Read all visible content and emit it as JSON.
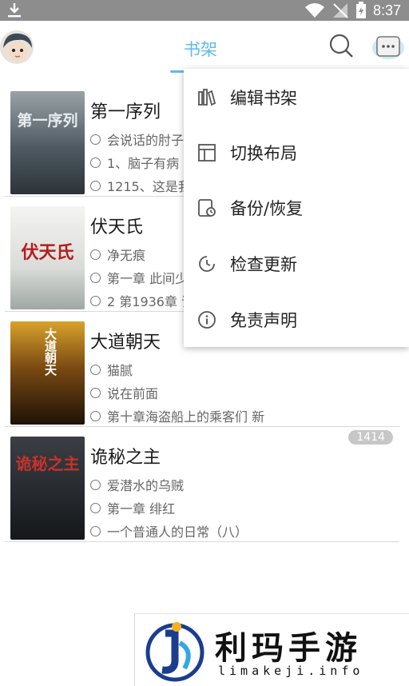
{
  "status_bar": {
    "time": "8:37"
  },
  "header": {
    "title": "书架"
  },
  "books": [
    {
      "title": "第一序列",
      "author": "会说话的肘子",
      "last_read": "1、脑子有病",
      "latest": "1215、这是我",
      "cover_text": "第一序列",
      "badge": ""
    },
    {
      "title": "伏天氏",
      "author": "净无痕",
      "last_read": "第一章 此间少",
      "latest": "2 第1936章 诸",
      "cover_text": "伏天氏",
      "badge": ""
    },
    {
      "title": "大道朝天",
      "author": "猫腻",
      "last_read": "说在前面",
      "latest": "第十章海盗船上的乘客们 新",
      "cover_text": "大道朝天",
      "badge": ""
    },
    {
      "title": "诡秘之主",
      "author": "爱潜水的乌贼",
      "last_read": "第一章 绯红",
      "latest": "一个普通人的日常（八）",
      "cover_text": "诡秘之主",
      "badge": "1414"
    }
  ],
  "menu": {
    "items": [
      {
        "label": "编辑书架",
        "icon": "bookshelf-icon"
      },
      {
        "label": "切换布局",
        "icon": "layout-icon"
      },
      {
        "label": "备份/恢复",
        "icon": "backup-icon"
      },
      {
        "label": "检查更新",
        "icon": "update-icon"
      },
      {
        "label": "免责声明",
        "icon": "info-icon"
      }
    ]
  },
  "watermark": {
    "text": "利玛手游",
    "url": "limakeji.info"
  },
  "colors": {
    "accent": "#5fb9f0",
    "status_bar": "#8d8d8d",
    "badge": "#c7c7c7"
  }
}
